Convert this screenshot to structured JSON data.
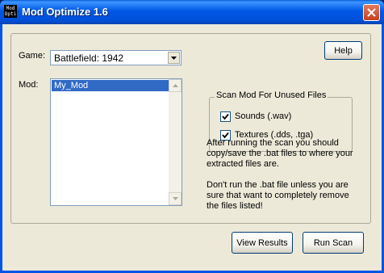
{
  "window": {
    "title": "Mod Optimize 1.6",
    "icon_text": "Mod Opti"
  },
  "form": {
    "game_label": "Game:",
    "game_selected": "Battlefield: 1942",
    "mod_label": "Mod:",
    "mods": [
      "My_Mod"
    ],
    "help_button": "Help"
  },
  "scan": {
    "legend": "Scan Mod For Unused Files",
    "options": [
      {
        "label": "Sounds (.wav)",
        "checked": true
      },
      {
        "label": "Textures (.dds, .tga)",
        "checked": true
      }
    ]
  },
  "info": {
    "paragraph1": "After running the scan you should copy/save the .bat files to where your extracted files are.",
    "paragraph2": "Don't run the .bat file unless you are sure that want to completely remove the files listed!"
  },
  "buttons": {
    "view_results": "View Results",
    "run_scan": "Run Scan"
  },
  "colors": {
    "titlebar": "#0058E6",
    "selection": "#316AC5",
    "dialog_bg": "#ECE9D8"
  }
}
